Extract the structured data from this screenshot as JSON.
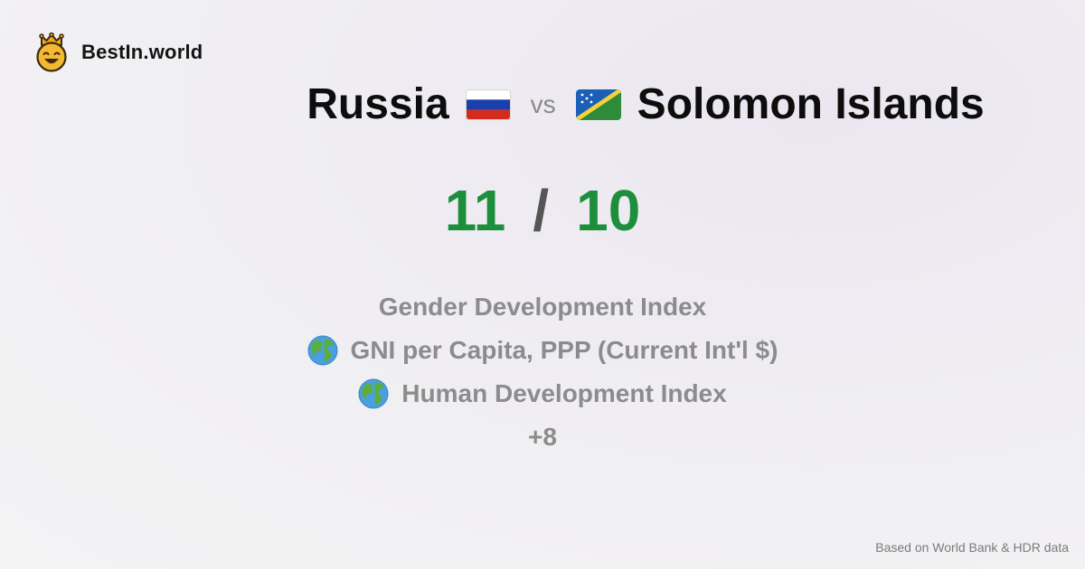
{
  "brand": {
    "name": "BestIn.world",
    "icon": "crown-smiley-icon",
    "colors": {
      "face": "#f5b931",
      "crown": "#f0a81e"
    }
  },
  "comparison": {
    "country_a": {
      "name": "Russia",
      "flag": "russia-flag-icon"
    },
    "vs_label": "vs",
    "country_b": {
      "name": "Solomon Islands",
      "flag": "solomon-islands-flag-icon"
    }
  },
  "score": {
    "a": "11",
    "separator": "/",
    "b": "10",
    "color": "#1d8f3c"
  },
  "metrics": [
    {
      "label": "Gender Development Index",
      "icon": ""
    },
    {
      "label": "GNI per Capita, PPP (Current Int'l $)",
      "icon": "globe-icon"
    },
    {
      "label": "Human Development Index",
      "icon": "globe-icon"
    }
  ],
  "more_label": "+8",
  "footer": {
    "source": "Based on World Bank & HDR data"
  }
}
